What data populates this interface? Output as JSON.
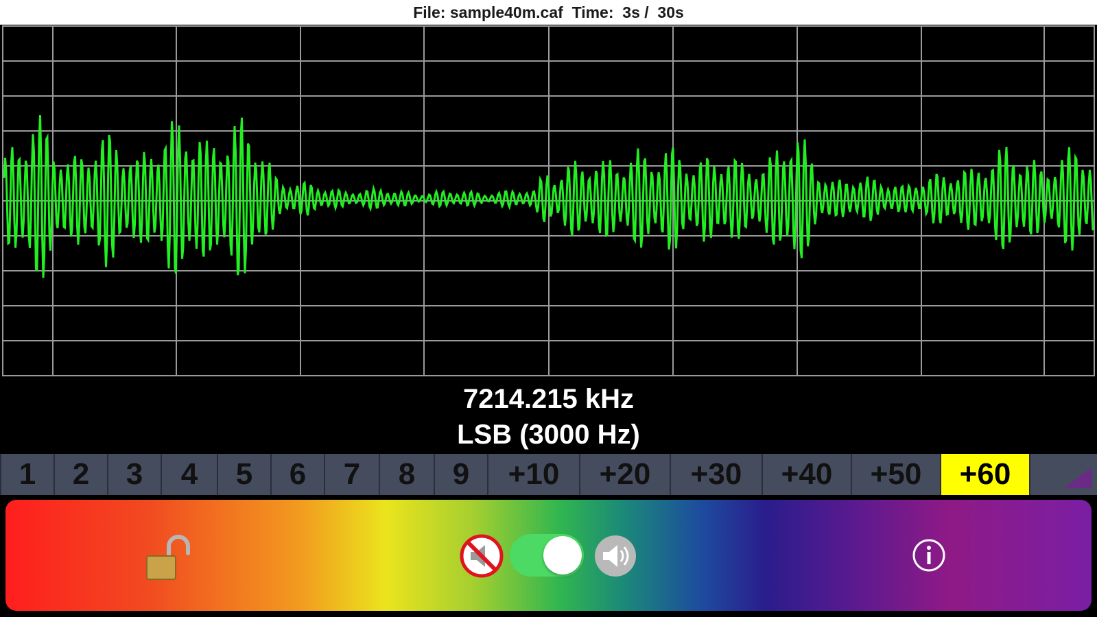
{
  "status": {
    "file_label": "File: sample40m.caf",
    "time_label": "Time:  3s /  30s"
  },
  "readout": {
    "frequency": "7214.215 kHz",
    "mode": "LSB (3000 Hz)"
  },
  "tuning_steps": [
    "1",
    "2",
    "3",
    "4",
    "5",
    "6",
    "7",
    "8",
    "9",
    "+10",
    "+20",
    "+30",
    "+40",
    "+50",
    "+60"
  ],
  "active_step": "+60",
  "controls": {
    "lock_icon": "unlocked-padlock-icon",
    "mute_icon": "mute-disabled-icon",
    "audio_toggle_on": true,
    "speaker_icon": "speaker-icon",
    "info_icon": "info-icon"
  },
  "colors": {
    "waveform": "#22ee22",
    "grid": "#9a9a9a",
    "active_step": "#ffff00",
    "toggle_on": "#4cd964"
  }
}
